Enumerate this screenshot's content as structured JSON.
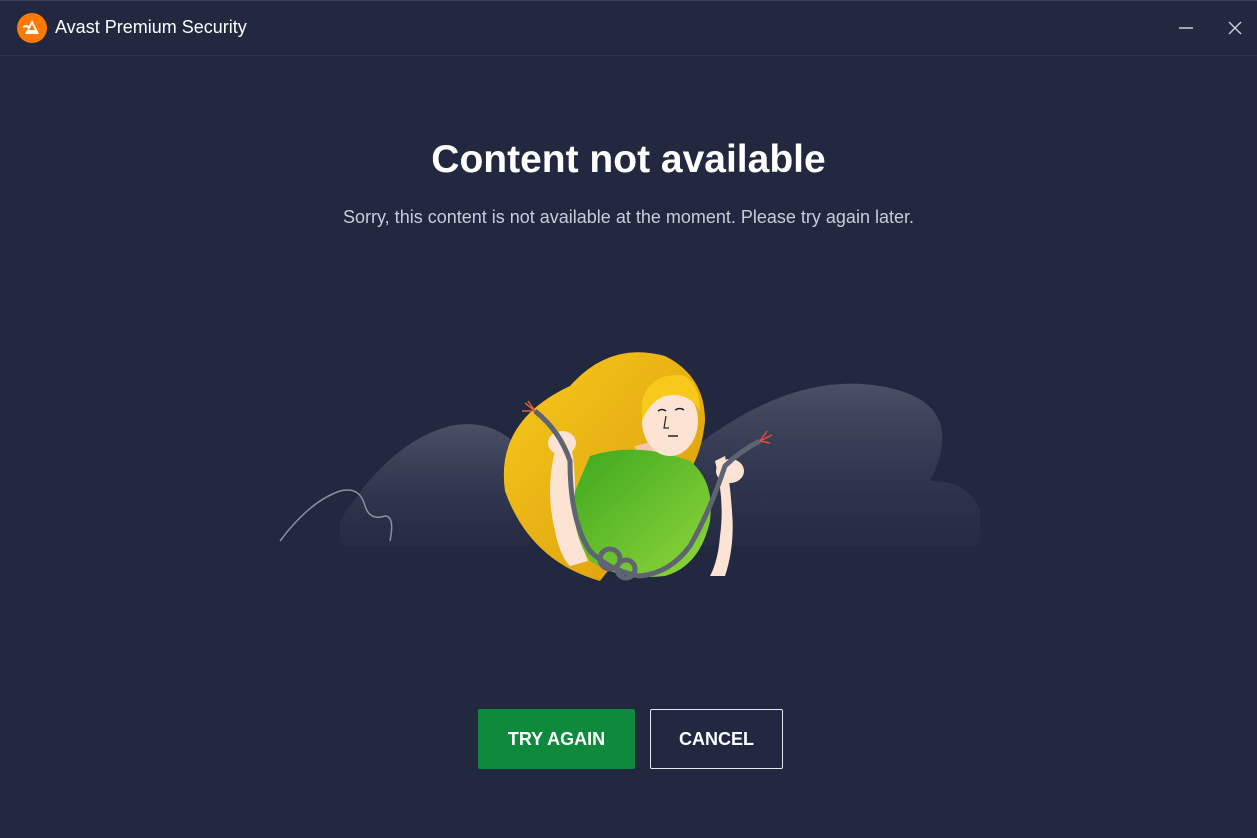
{
  "window": {
    "title": "Avast Premium Security",
    "minimize_icon": "minimize-icon",
    "close_icon": "close-icon"
  },
  "content": {
    "heading": "Content not available",
    "message": "Sorry, this content is not available at the moment. Please try again later."
  },
  "illustration": {
    "description_icon": "woman-holding-cut-cable-illustration"
  },
  "actions": {
    "try_again_label": "TRY AGAIN",
    "cancel_label": "CANCEL"
  },
  "colors": {
    "background": "#212840",
    "accent_orange": "#ff7800",
    "primary_button": "#0f8a3c",
    "text_primary": "#ffffff",
    "text_secondary": "#c9cdd8"
  }
}
